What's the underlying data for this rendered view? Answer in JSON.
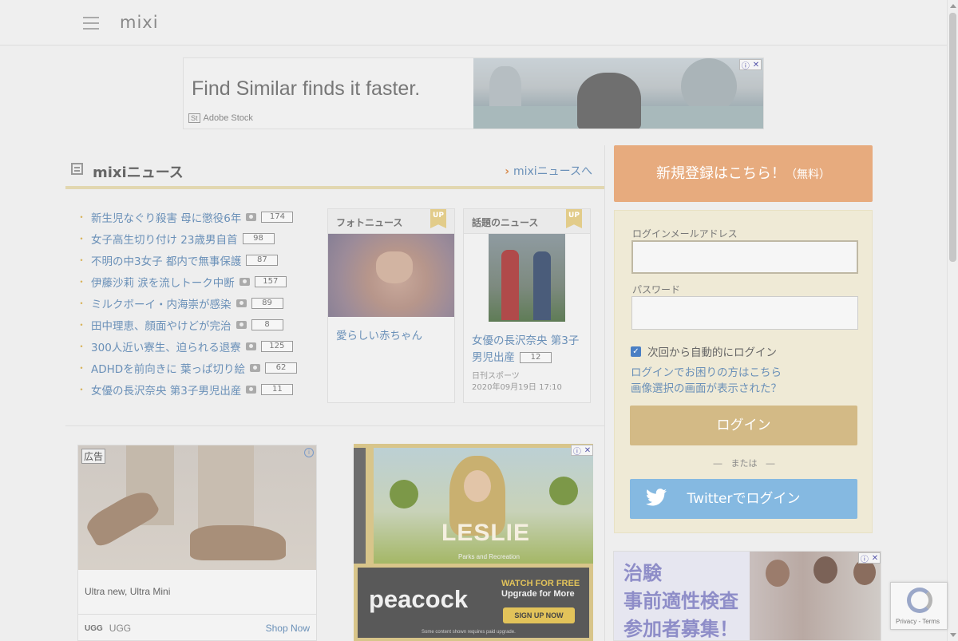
{
  "header": {
    "logo": "mixi"
  },
  "top_ad": {
    "headline": "Find Similar finds it faster.",
    "brand_mark": "St",
    "brand": "Adobe Stock"
  },
  "news": {
    "title": "mixiニュース",
    "link": "mixiニュースへ",
    "items": [
      {
        "title": "新生児なぐり殺害 母に懲役6年",
        "photo": true,
        "count": "174"
      },
      {
        "title": "女子高生切り付け 23歳男自首",
        "photo": false,
        "count": "98"
      },
      {
        "title": "不明の中3女子 都内で無事保護",
        "photo": false,
        "count": "87"
      },
      {
        "title": "伊藤沙莉 涙を流しトーク中断",
        "photo": true,
        "count": "157"
      },
      {
        "title": "ミルクボーイ・内海崇が感染",
        "photo": true,
        "count": "89"
      },
      {
        "title": "田中理恵、顔面やけどが完治",
        "photo": true,
        "count": "8"
      },
      {
        "title": "300人近い寮生、迫られる退寮",
        "photo": true,
        "count": "125"
      },
      {
        "title": "ADHDを前向きに 葉っぱ切り絵",
        "photo": true,
        "count": "62"
      },
      {
        "title": "女優の長沢奈央 第3子男児出産",
        "photo": true,
        "count": "11"
      }
    ],
    "photo_card": {
      "head": "フォトニュース",
      "badge": "UP",
      "text": "愛らしい赤ちゃん"
    },
    "topic_card": {
      "head": "話題のニュース",
      "badge": "UP",
      "text": "女優の長沢奈央 第3子男児出産",
      "count": "12",
      "source": "日刊スポーツ",
      "date": "2020年09月19日 17:10"
    }
  },
  "ad_ugg": {
    "label": "広告",
    "caption": "Ultra new, Ultra Mini",
    "logo": "UGG",
    "brand": "UGG",
    "cta": "Shop Now"
  },
  "ad_peacock": {
    "title": "LESLIE",
    "subtitle": "Parks and Recreation",
    "brand": "peacock",
    "line1": "WATCH FOR FREE",
    "line2": "Upgrade for More",
    "cta": "SIGN UP NOW",
    "fine": "Some content shown requires paid upgrade."
  },
  "register": {
    "label": "新規登録はこちら！",
    "free": "（無料）"
  },
  "login": {
    "email_label": "ログインメールアドレス",
    "email_value": "",
    "password_label": "パスワード",
    "password_value": "",
    "remember_label": "次回から自動的にログイン",
    "remember_checked": true,
    "help1": "ログインでお困りの方はこちら",
    "help2": "画像選択の画面が表示された？",
    "login_button": "ログイン",
    "or": "―　または　―",
    "twitter_button": "Twitterでログイン"
  },
  "ad_clinic": {
    "line1": "治験",
    "line2": "事前適性検査",
    "line3": "参加者募集！"
  },
  "recaptcha": {
    "terms": "Privacy - Terms"
  },
  "colors": {
    "link": "#6a90b8",
    "register": "#e7ab7e",
    "login": "#d3ba86",
    "twitter": "#85b9e1",
    "accent_line": "#e2d7b0"
  },
  "icons": [
    "hamburger-icon",
    "newspaper-icon",
    "camera-icon",
    "twitter-bird-icon",
    "adchoices-icon",
    "close-icon",
    "recaptcha-icon"
  ]
}
